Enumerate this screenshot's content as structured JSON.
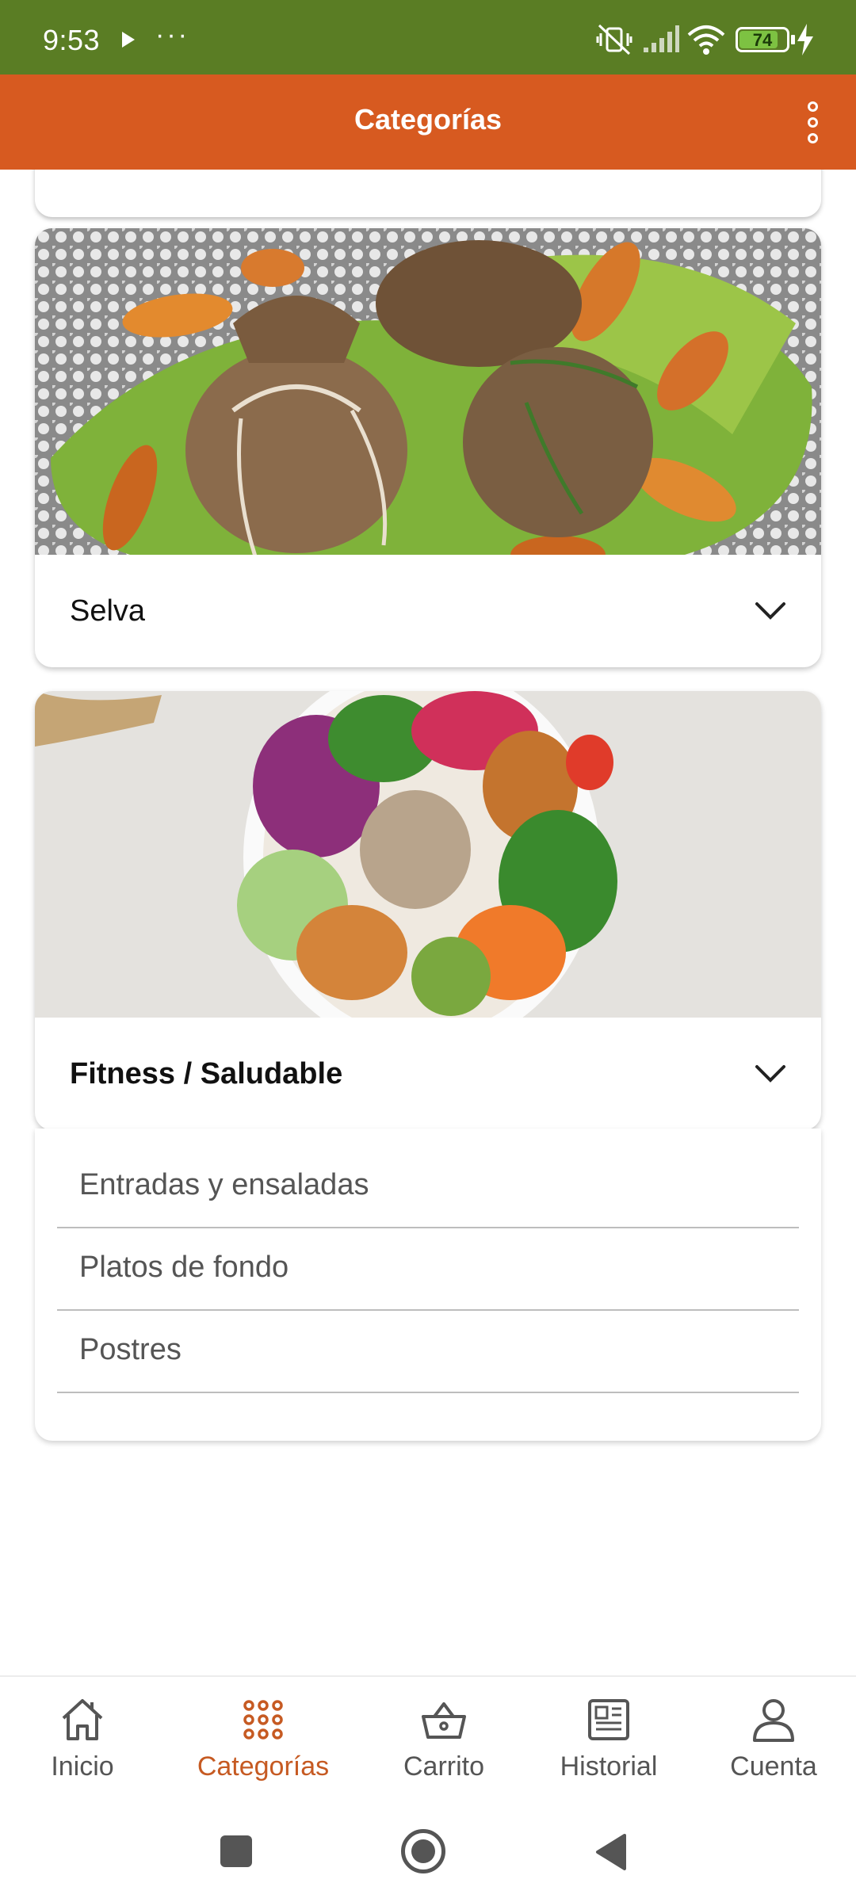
{
  "status_bar": {
    "time": "9:53",
    "overflow": "···",
    "battery_level": "74",
    "background_color": "#5a7d24"
  },
  "app_bar": {
    "title": "Categorías",
    "background_color": "#d75a20"
  },
  "categories": [
    {
      "label": "Selva",
      "expanded": false
    },
    {
      "label": "Fitness / Saludable",
      "expanded": true,
      "subcategories": [
        "Entradas y ensaladas",
        "Platos de fondo",
        "Postres"
      ]
    }
  ],
  "bottom_nav": {
    "active": "Categorías",
    "accent_color": "#c65a22",
    "items": [
      {
        "label": "Inicio",
        "icon": "home-icon"
      },
      {
        "label": "Categorías",
        "icon": "grid-dots-icon"
      },
      {
        "label": "Carrito",
        "icon": "basket-icon"
      },
      {
        "label": "Historial",
        "icon": "newspaper-icon"
      },
      {
        "label": "Cuenta",
        "icon": "person-icon"
      }
    ]
  },
  "system_nav": {
    "icons": [
      "recents-square-icon",
      "home-circle-icon",
      "back-triangle-icon"
    ]
  }
}
